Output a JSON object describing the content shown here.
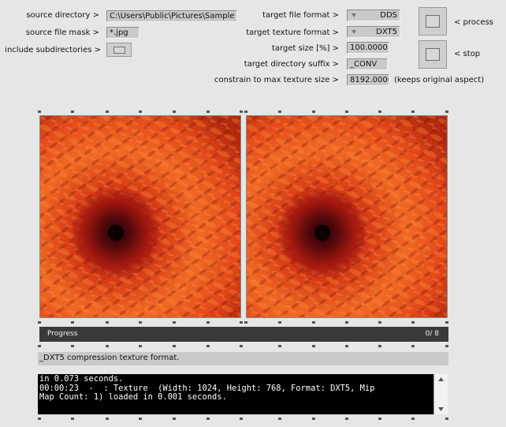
{
  "labels": {
    "source_directory": "source directory >",
    "source_file_mask": "source file mask >",
    "include_subdirectories": "include subdirectories >",
    "target_file_format": "target file format >",
    "target_texture_format": "target texture format >",
    "target_size": "target size [%] >",
    "target_directory_suffix": "target directory suffix >",
    "constrain_max_texture": "constrain to max texture size >",
    "keeps_aspect": "(keeps original aspect)",
    "process": "< process",
    "stop": "< stop"
  },
  "fields": {
    "source_directory": "C:\\Users\\Public\\Pictures\\Sample",
    "source_file_mask": "*.jpg",
    "target_file_format": "DDS",
    "target_texture_format": "DXT5",
    "target_size": "100.0000",
    "target_directory_suffix": "_CONV",
    "max_texture_size": "8192.0000"
  },
  "progress": {
    "label": "Progress",
    "count": "0/ 8",
    "fraction": 0
  },
  "message": "_DXT5 compression texture format.",
  "console": {
    "lines": [
      "in 0.073 seconds.",
      "00:00:23  -  : Texture  (Width: 1024, Height: 768, Format: DXT5, Mip",
      "Map Count: 1) loaded in 0.001 seconds."
    ]
  },
  "icons": {
    "scroll_up": "scroll-up-arrow-icon",
    "scroll_down": "scroll-down-arrow-icon"
  },
  "colors": {
    "background": "#e6e6e6",
    "progress_bar": "#3a3a3a",
    "console_bg": "#000000",
    "flower_primary": "#e8501c"
  }
}
